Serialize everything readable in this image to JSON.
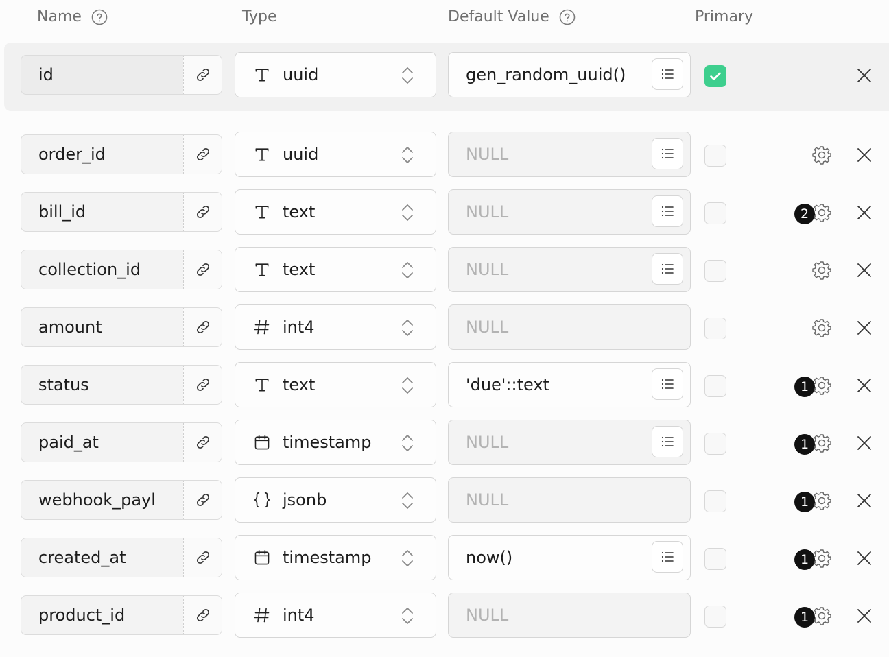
{
  "header": {
    "name_label": "Name",
    "type_label": "Type",
    "default_label": "Default Value",
    "primary_label": "Primary"
  },
  "columns": [
    {
      "name": "id",
      "type": "uuid",
      "type_icon": "text-type-icon",
      "default": "gen_random_uuid()",
      "default_is_null": false,
      "has_default_menu": true,
      "primary": true,
      "show_settings": false,
      "badge": ""
    },
    {
      "name": "order_id",
      "type": "uuid",
      "type_icon": "text-type-icon",
      "default": "NULL",
      "default_is_null": true,
      "has_default_menu": true,
      "primary": false,
      "show_settings": true,
      "badge": ""
    },
    {
      "name": "bill_id",
      "type": "text",
      "type_icon": "text-type-icon",
      "default": "NULL",
      "default_is_null": true,
      "has_default_menu": true,
      "primary": false,
      "show_settings": true,
      "badge": "2"
    },
    {
      "name": "collection_id",
      "type": "text",
      "type_icon": "text-type-icon",
      "default": "NULL",
      "default_is_null": true,
      "has_default_menu": true,
      "primary": false,
      "show_settings": true,
      "badge": ""
    },
    {
      "name": "amount",
      "type": "int4",
      "type_icon": "hash-icon",
      "default": "NULL",
      "default_is_null": true,
      "has_default_menu": false,
      "primary": false,
      "show_settings": true,
      "badge": ""
    },
    {
      "name": "status",
      "type": "text",
      "type_icon": "text-type-icon",
      "default": "'due'::text",
      "default_is_null": false,
      "has_default_menu": true,
      "primary": false,
      "show_settings": true,
      "badge": "1"
    },
    {
      "name": "paid_at",
      "type": "timestamp",
      "type_icon": "calendar-icon",
      "default": "NULL",
      "default_is_null": true,
      "has_default_menu": true,
      "primary": false,
      "show_settings": true,
      "badge": "1"
    },
    {
      "name": "webhook_payl",
      "type": "jsonb",
      "type_icon": "braces-icon",
      "default": "NULL",
      "default_is_null": true,
      "has_default_menu": false,
      "primary": false,
      "show_settings": true,
      "badge": "1"
    },
    {
      "name": "created_at",
      "type": "timestamp",
      "type_icon": "calendar-icon",
      "default": "now()",
      "default_is_null": false,
      "has_default_menu": true,
      "primary": false,
      "show_settings": true,
      "badge": "1"
    },
    {
      "name": "product_id",
      "type": "int4",
      "type_icon": "hash-icon",
      "default": "NULL",
      "default_is_null": true,
      "has_default_menu": false,
      "primary": false,
      "show_settings": true,
      "badge": "1"
    }
  ],
  "colors": {
    "primary_check": "#3ecf8e",
    "badge_bg": "#111111"
  }
}
